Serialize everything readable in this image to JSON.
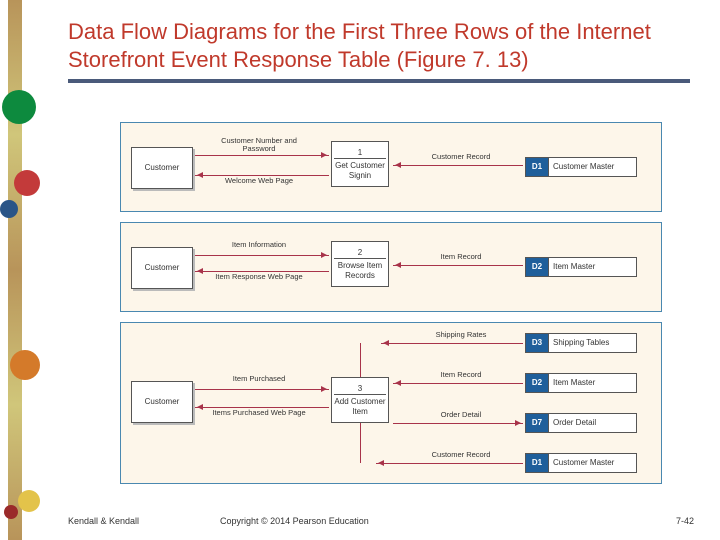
{
  "title": "Data Flow Diagrams for the First Three Rows of the Internet Storefront Event Response Table (Figure 7. 13)",
  "footer": {
    "left": "Kendall & Kendall",
    "center": "Copyright © 2014 Pearson Education",
    "right": "7-42"
  },
  "panels": [
    {
      "entity": "Customer",
      "process": {
        "num": "1",
        "name": "Get Customer Signin"
      },
      "flows_entity": [
        {
          "label": "Customer Number and Password",
          "dir": "to_process"
        },
        {
          "label": "Welcome Web Page",
          "dir": "to_entity"
        }
      ],
      "datastores": [
        {
          "id": "D1",
          "name": "Customer Master",
          "flow": "Customer Record",
          "dir": "to_process"
        }
      ]
    },
    {
      "entity": "Customer",
      "process": {
        "num": "2",
        "name": "Browse Item Records"
      },
      "flows_entity": [
        {
          "label": "Item Information",
          "dir": "to_process"
        },
        {
          "label": "Item Response Web Page",
          "dir": "to_entity"
        }
      ],
      "datastores": [
        {
          "id": "D2",
          "name": "Item Master",
          "flow": "Item Record",
          "dir": "to_process"
        }
      ]
    },
    {
      "entity": "Customer",
      "process": {
        "num": "3",
        "name": "Add Customer Item"
      },
      "flows_entity": [
        {
          "label": "Item Purchased",
          "dir": "to_process"
        },
        {
          "label": "Items Purchased Web Page",
          "dir": "to_entity"
        }
      ],
      "datastores": [
        {
          "id": "D3",
          "name": "Shipping Tables",
          "flow": "Shipping Rates",
          "dir": "to_process"
        },
        {
          "id": "D2",
          "name": "Item Master",
          "flow": "Item Record",
          "dir": "to_process"
        },
        {
          "id": "D7",
          "name": "Order Detail",
          "flow": "Order Detail",
          "dir": "to_store"
        },
        {
          "id": "D1",
          "name": "Customer Master",
          "flow": "Customer Record",
          "dir": "to_process"
        }
      ]
    }
  ]
}
